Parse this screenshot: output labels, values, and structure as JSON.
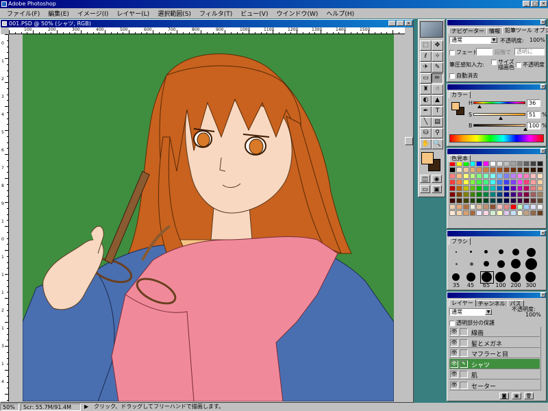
{
  "app": {
    "title": "Adobe Photoshop"
  },
  "menu": [
    "ファイル(F)",
    "編集(E)",
    "イメージ(I)",
    "レイヤー(L)",
    "選択範囲(S)",
    "フィルタ(T)",
    "ビュー(V)",
    "ウインドウ(W)",
    "ヘルプ(H)"
  ],
  "document": {
    "title": "001.PSD @ 50% (シャツ, RGB)",
    "hruler": [
      "100",
      "200",
      "300",
      "400",
      "500",
      "600",
      "700",
      "800",
      "900",
      "1000",
      "1100",
      "1200",
      "1300",
      "1400",
      "1500"
    ],
    "vruler": [
      "0",
      "1",
      "2",
      "3",
      "4",
      "5",
      "6",
      "7",
      "8",
      "9",
      "1",
      "0",
      "1",
      "1",
      "1",
      "2",
      "1",
      "3",
      "1",
      "4"
    ]
  },
  "status": {
    "zoom": "50%",
    "scr": "Scr: 55.7M/91.4M",
    "message": "クリック、ドラッグしてフリーハンドで描画します。"
  },
  "navigator_panel": {
    "tabs": [
      "ナビゲーター",
      "情報",
      "鉛筆ツール オプション"
    ],
    "mode": "通常",
    "opacity_label": "不透明度:",
    "opacity_value": "100%",
    "fade_label": "フェード:",
    "fade_unit": "段階で",
    "fade_to": "透明に",
    "pressure_label": "筆圧感知入力:",
    "size_label": "サイズ",
    "color_label": "描画色",
    "pressure_opacity": "不透明度",
    "auto_erase": "自動消去"
  },
  "color_panel": {
    "tab": "カラー",
    "channels": [
      {
        "label": "H",
        "value": "36",
        "unit": ""
      },
      {
        "label": "S",
        "value": "51",
        "unit": "%"
      },
      {
        "label": "B",
        "value": "100",
        "unit": "%"
      }
    ],
    "foreground": "#f6c483",
    "background": "#3a2410"
  },
  "swatches_panel": {
    "tab": "色見本",
    "colors": [
      "#ff0000",
      "#ffff00",
      "#00ff00",
      "#00ffff",
      "#0000ff",
      "#ff00ff",
      "#ffffff",
      "#e0e0e0",
      "#c0c0c0",
      "#a0a0a0",
      "#808080",
      "#606060",
      "#404040",
      "#202020",
      "#000000",
      "#f8e0c8",
      "#f0c8a0",
      "#e8b078",
      "#d89858",
      "#c88040",
      "#b86830",
      "#a05020",
      "#884018",
      "#703010",
      "#582808",
      "#402000",
      "#301800",
      "#201000",
      "#ff8080",
      "#ffc080",
      "#ffff80",
      "#c0ff80",
      "#80ff80",
      "#80ffc0",
      "#80ffff",
      "#80c0ff",
      "#8080ff",
      "#c080ff",
      "#ff80ff",
      "#ff80c0",
      "#ffc0c0",
      "#ffe0c0",
      "#ff4040",
      "#ff8040",
      "#ffff40",
      "#80ff40",
      "#40ff40",
      "#40ff80",
      "#40ffff",
      "#4080ff",
      "#4040ff",
      "#8040ff",
      "#ff40ff",
      "#ff4080",
      "#ffa0a0",
      "#ffd0a0",
      "#c00000",
      "#c06000",
      "#c0c000",
      "#60c000",
      "#00c000",
      "#00c060",
      "#00c0c0",
      "#0060c0",
      "#0000c0",
      "#6000c0",
      "#c000c0",
      "#c00060",
      "#e08080",
      "#e0b080",
      "#800000",
      "#804000",
      "#808000",
      "#408000",
      "#008000",
      "#008040",
      "#008080",
      "#004080",
      "#000080",
      "#400080",
      "#800080",
      "#800040",
      "#a06060",
      "#a08060",
      "#400000",
      "#402000",
      "#404000",
      "#204000",
      "#004000",
      "#004020",
      "#004040",
      "#002040",
      "#000040",
      "#200040",
      "#400040",
      "#400020",
      "#603030",
      "#604830",
      "#f0d0b0",
      "#e8a878",
      "#b07040",
      "#f0f0e0",
      "#e0c0a0",
      "#c09070",
      "#905030",
      "#f8c0c0",
      "#e08888",
      "#ff0000",
      "#c0ffc0",
      "#a0d0ff",
      "#e0e0ff",
      "#f0f0f0",
      "#ffe8d0",
      "#f8d8b0",
      "#d8a070",
      "#a86838",
      "#e8e8ff",
      "#ffd8e8",
      "#d0f0d0",
      "#ffffc0",
      "#e0c8f0",
      "#c8e0f8",
      "#f8f8d8",
      "#c0a080",
      "#906848",
      "#684020"
    ]
  },
  "brush_panel": {
    "tab": "ブラシ",
    "labels": [
      "35",
      "45",
      "65",
      "100",
      "200",
      "300"
    ]
  },
  "layers_panel": {
    "tabs": [
      "レイヤー",
      "チャンネル",
      "パス"
    ],
    "mode": "通常",
    "opacity_label": "不透明度:",
    "opacity_value": "100%",
    "preserve_label": "透明部分の保護",
    "layers": [
      {
        "name": "線画",
        "visible": true,
        "active": false
      },
      {
        "name": "髪とメガネ",
        "visible": true,
        "active": false
      },
      {
        "name": "マフラーと目",
        "visible": true,
        "active": false
      },
      {
        "name": "シャツ",
        "visible": true,
        "active": true
      },
      {
        "name": "肌",
        "visible": true,
        "active": false
      },
      {
        "name": "セーター",
        "visible": true,
        "active": false
      }
    ]
  }
}
